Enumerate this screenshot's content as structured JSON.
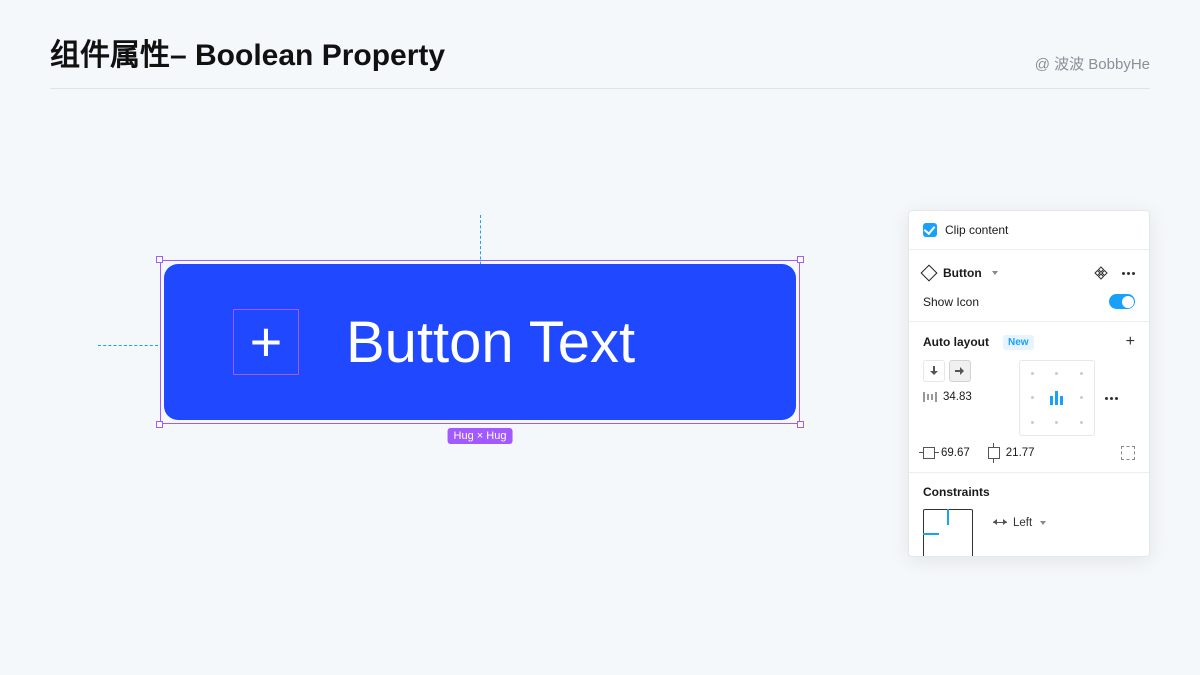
{
  "header": {
    "title": "组件属性– Boolean Property",
    "author": "@ 波波 BobbyHe"
  },
  "canvas": {
    "button_label": "Button Text",
    "dimension_badge": "Hug × Hug",
    "plus_glyph": "+"
  },
  "panel": {
    "clip": {
      "checked": true,
      "label": "Clip content"
    },
    "component": {
      "name": "Button",
      "property_label": "Show Icon",
      "property_value": true
    },
    "auto_layout": {
      "title": "Auto layout",
      "badge": "New",
      "direction": "horizontal",
      "gap": "34.83",
      "padding_h": "69.67",
      "padding_v": "21.77"
    },
    "constraints": {
      "title": "Constraints",
      "horizontal": "Left"
    }
  }
}
